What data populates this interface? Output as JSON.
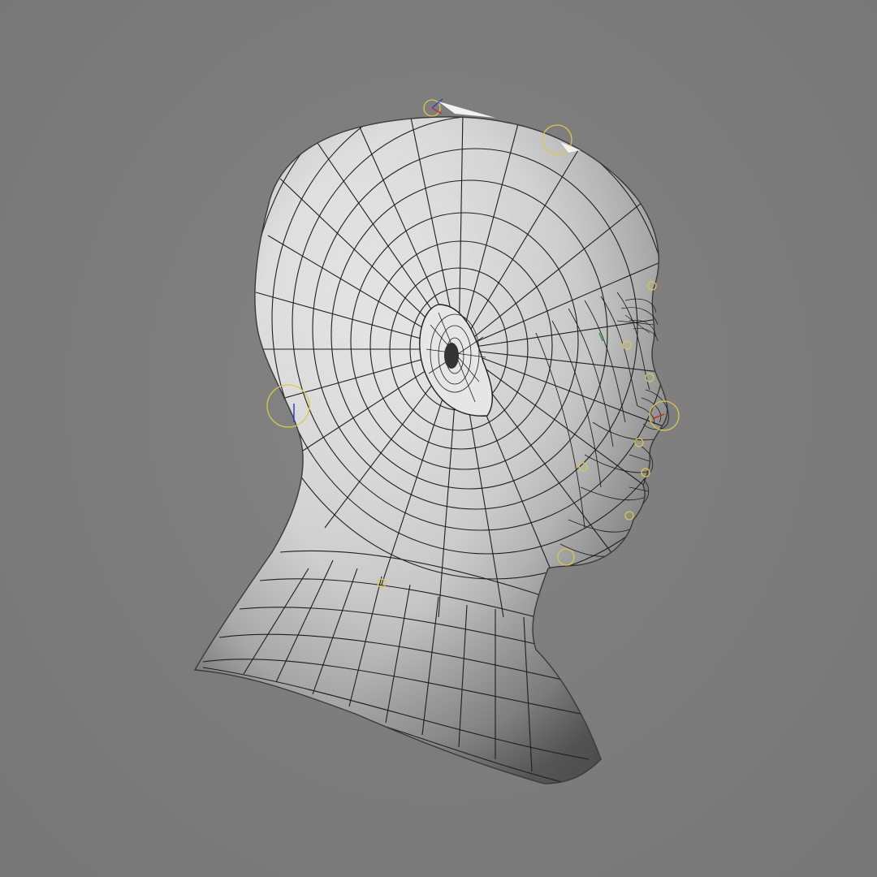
{
  "viewport": {
    "background_color": "#7b7b7b",
    "model": "head-bust-wireframe",
    "mesh_color": "#efefef",
    "wire_color": "#1e1e1e",
    "rig_control_color": "#d9c84a",
    "axis_colors": {
      "x": "#c03030",
      "y": "#3a9a3a",
      "z": "#3a3ad0"
    }
  }
}
